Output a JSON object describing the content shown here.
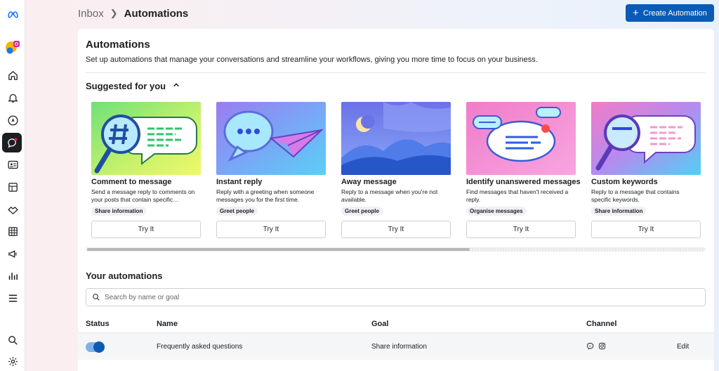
{
  "header": {
    "breadcrumb_parent": "Inbox",
    "breadcrumb_current": "Automations",
    "create_label": "Create Automation"
  },
  "rail": {
    "icons": [
      "meta-logo-icon",
      "account-avatar-icon",
      "home-icon",
      "bell-icon",
      "compass-icon",
      "chat-icon",
      "contact-card-icon",
      "pages-icon",
      "handshake-icon",
      "table-icon",
      "megaphone-icon",
      "bar-chart-icon",
      "menu-icon",
      "search-icon",
      "settings-icon"
    ]
  },
  "panel": {
    "title": "Automations",
    "subtitle": "Set up automations that manage your conversations and streamline your workflows, giving you more time to focus on your business.",
    "suggested_title": "Suggested for you"
  },
  "cards": [
    {
      "title": "Comment to message",
      "desc": "Send a message reply to comments on your posts that contain specific…",
      "tag": "Share information",
      "button": "Try It"
    },
    {
      "title": "Instant reply",
      "desc": "Reply with a greeting when someone messages you for the first time.",
      "tag": "Greet people",
      "button": "Try It"
    },
    {
      "title": "Away message",
      "desc": "Reply to a message when you're not available.",
      "tag": "Greet people",
      "button": "Try It"
    },
    {
      "title": "Identify unanswered messages",
      "desc": "Find messages that haven't received a reply.",
      "tag": "Organise messages",
      "button": "Try It"
    },
    {
      "title": "Custom keywords",
      "desc": "Reply to a message that contains specific keywords.",
      "tag": "Share information",
      "button": "Try It"
    }
  ],
  "your": {
    "title": "Your automations",
    "search_placeholder": "Search by name or goal",
    "columns": [
      "Status",
      "Name",
      "Goal",
      "Channel"
    ],
    "rows": [
      {
        "status_on": true,
        "name": "Frequently asked questions",
        "goal": "Share information",
        "channels": [
          "messenger-icon",
          "instagram-icon"
        ],
        "action": "Edit"
      }
    ]
  },
  "colors": {
    "accent": "#0a5bb5"
  }
}
